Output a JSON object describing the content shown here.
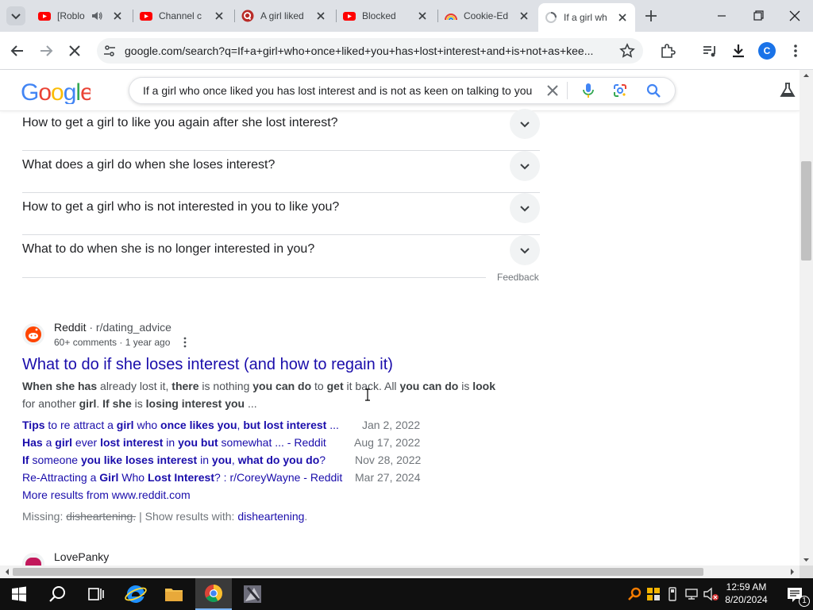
{
  "browser": {
    "tabs": [
      {
        "title": "[Roblo",
        "icon": "youtube-icon"
      },
      {
        "title": "Channel c",
        "icon": "youtube-icon"
      },
      {
        "title": "A girl liked",
        "icon": "quora-icon"
      },
      {
        "title": "Blocked",
        "icon": "youtube-icon"
      },
      {
        "title": "Cookie-Ed",
        "icon": "rainbow-icon"
      },
      {
        "title": "If a girl wh",
        "icon": "loading-icon"
      }
    ],
    "url": "google.com/search?q=If+a+girl+who+once+liked+you+has+lost+interest+and+is+not+as+kee...",
    "profile_initial": "C"
  },
  "google": {
    "logo": "Google",
    "query": "If a girl who once liked you has lost interest and is not as keen on talking to you"
  },
  "paa": {
    "questions": [
      "How to get a girl to like you again after she lost interest?",
      "What does a girl do when she loses interest?",
      "How to get a girl who is not interested in you to like you?",
      "What to do when she is no longer interested in you?"
    ],
    "feedback": "Feedback"
  },
  "result1": {
    "site": "Reddit",
    "path": " · r/dating_advice",
    "meta": "60+ comments · 1 year ago",
    "title": "What to do if she loses interest (and how to regain it)",
    "snippet": {
      "s1": "When she has",
      "s2": " already lost it, ",
      "s3": "there",
      "s4": " is nothing ",
      "s5": "you can do",
      "s6": " to ",
      "s7": "get",
      "s8": " it back. All ",
      "s9": "you can do",
      "s10": " is ",
      "s11": "look",
      "s12": "for another ",
      "s13": "girl",
      "s14": ". ",
      "s15": "If she",
      "s16": " is ",
      "s17": "losing interest you",
      "s18": " ..."
    },
    "sublinks": [
      {
        "date": "Jan 2, 2022",
        "p": [
          "Tips",
          " to re attract a ",
          "girl",
          " ",
          "who",
          " ",
          "once likes you",
          ", ",
          "but lost interest",
          " ..."
        ]
      },
      {
        "date": "Aug 17, 2022",
        "p": [
          "Has",
          " a ",
          "girl",
          " ever ",
          "lost interest",
          " in ",
          "you but",
          " somewhat ... - Reddit"
        ]
      },
      {
        "date": "Nov 28, 2022",
        "p": [
          "If",
          " someone ",
          "you like loses interest",
          " in ",
          "you",
          ", ",
          "what do you do",
          "?"
        ]
      },
      {
        "date": "Mar 27, 2024",
        "p": [
          "Re-Attracting a ",
          "Girl",
          " Who ",
          "Lost Interest",
          "? : r/CoreyWayne - Reddit"
        ]
      }
    ],
    "more": "More results from www.reddit.com",
    "missing_label": "Missing: ",
    "missing_term": "disheartening.",
    "show_label": " | Show results with: ",
    "show_term": "disheartening",
    "show_end": "."
  },
  "result2": {
    "site": "LovePanky"
  },
  "taskbar": {
    "time": "12:59 AM",
    "date": "8/20/2024",
    "notification_count": "1"
  }
}
